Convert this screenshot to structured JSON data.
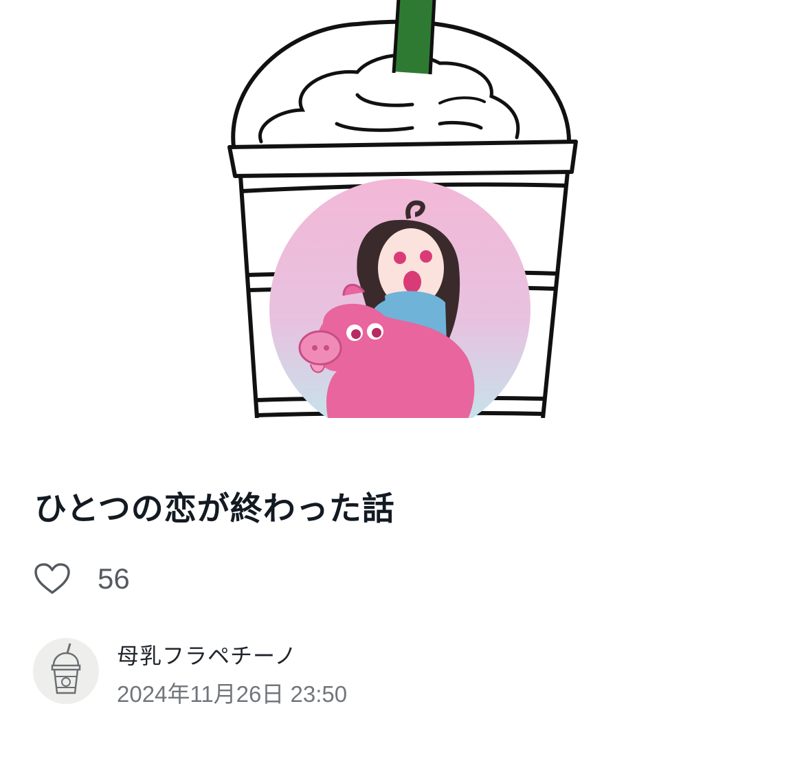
{
  "header_image": {
    "description_icon": "frappuccino-cup-with-character-sticker"
  },
  "article": {
    "title": "ひとつの恋が終わった話",
    "likes": "56"
  },
  "author": {
    "name": "母乳フラペチーノ",
    "date": "2024年11月26日 23:50",
    "avatar_icon": "frappuccino-cup-icon"
  },
  "colors": {
    "straw": "#2f7a33",
    "sticker_top": "#f2b8d6",
    "sticker_bottom": "#bfe9ec",
    "pig": "#e8659e",
    "text": "#131a22",
    "muted": "#71767c"
  }
}
